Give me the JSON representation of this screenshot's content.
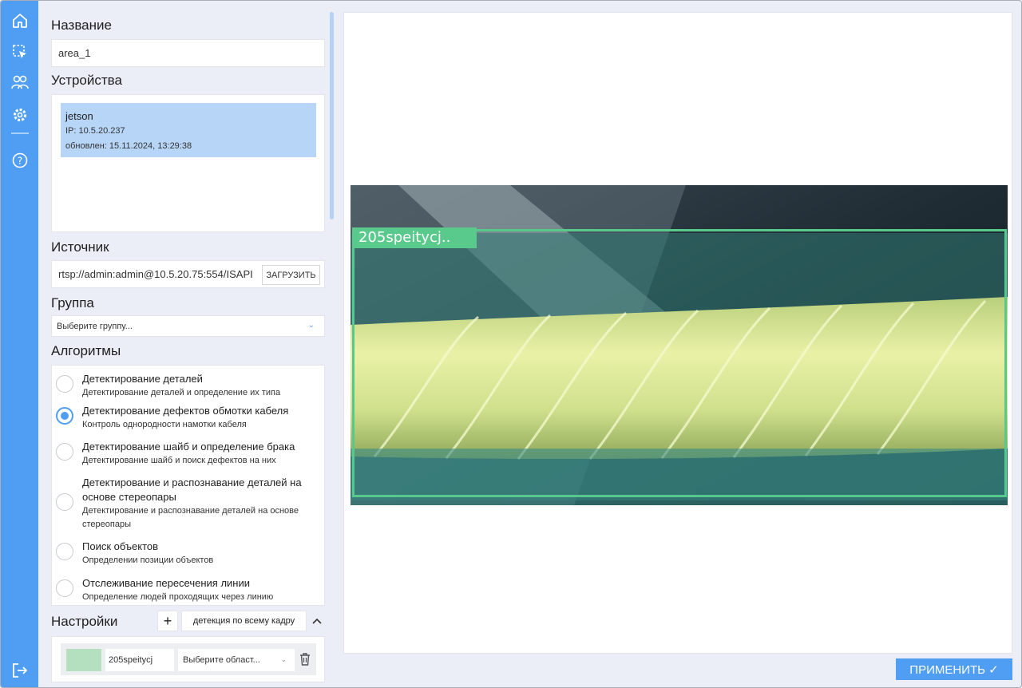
{
  "nav": {
    "icons": [
      "home-icon",
      "selection-icon",
      "users-icon",
      "settings-gear-icon",
      "help-icon",
      "logout-icon"
    ]
  },
  "name_section": {
    "title": "Название",
    "value": "area_1"
  },
  "devices_section": {
    "title": "Устройства",
    "items": [
      {
        "name": "jetson",
        "ip": "IP: 10.5.20.237",
        "updated": "обновлен: 15.11.2024, 13:29:38"
      }
    ]
  },
  "source_section": {
    "title": "Источник",
    "value": "rtsp://admin:admin@10.5.20.75:554/ISAPI",
    "load_label": "ЗАГРУЗИТЬ"
  },
  "group_section": {
    "title": "Группа",
    "placeholder": "Выберите группу..."
  },
  "algorithms_section": {
    "title": "Алгоритмы",
    "items": [
      {
        "title": "Детектирование деталей",
        "desc": "Детектирование деталей и определение их типа",
        "selected": false
      },
      {
        "title": "Детектирование дефектов обмотки кабеля",
        "desc": "Контроль однородности намотки кабеля",
        "selected": true
      },
      {
        "title": "Детектирование шайб и определение брака",
        "desc": "Детектирование шайб и поиск дефектов на них",
        "selected": false
      },
      {
        "title": "Детектирование и распознавание деталей на основе стереопары",
        "desc": "Детектирование и распознавание деталей на основе стереопары",
        "selected": false
      },
      {
        "title": "Поиск объектов",
        "desc": "Определении позиции объектов",
        "selected": false
      },
      {
        "title": "Отслеживание пересечения линии",
        "desc": "Определение людей проходящих через линию",
        "selected": false
      }
    ]
  },
  "settings_section": {
    "title": "Настройки",
    "add_label": "+",
    "mode_label": "детекция по всему кадру",
    "collapse_icon": "chevron-up-icon",
    "rows": [
      {
        "color": "#b5e0c0",
        "name": "205speitycj",
        "area_placeholder": "Выберите област..."
      }
    ]
  },
  "preview": {
    "detection_label": "205speitycj..",
    "box_color": "#57c98a"
  },
  "apply_label": "ПРИМЕНИТЬ ✓"
}
